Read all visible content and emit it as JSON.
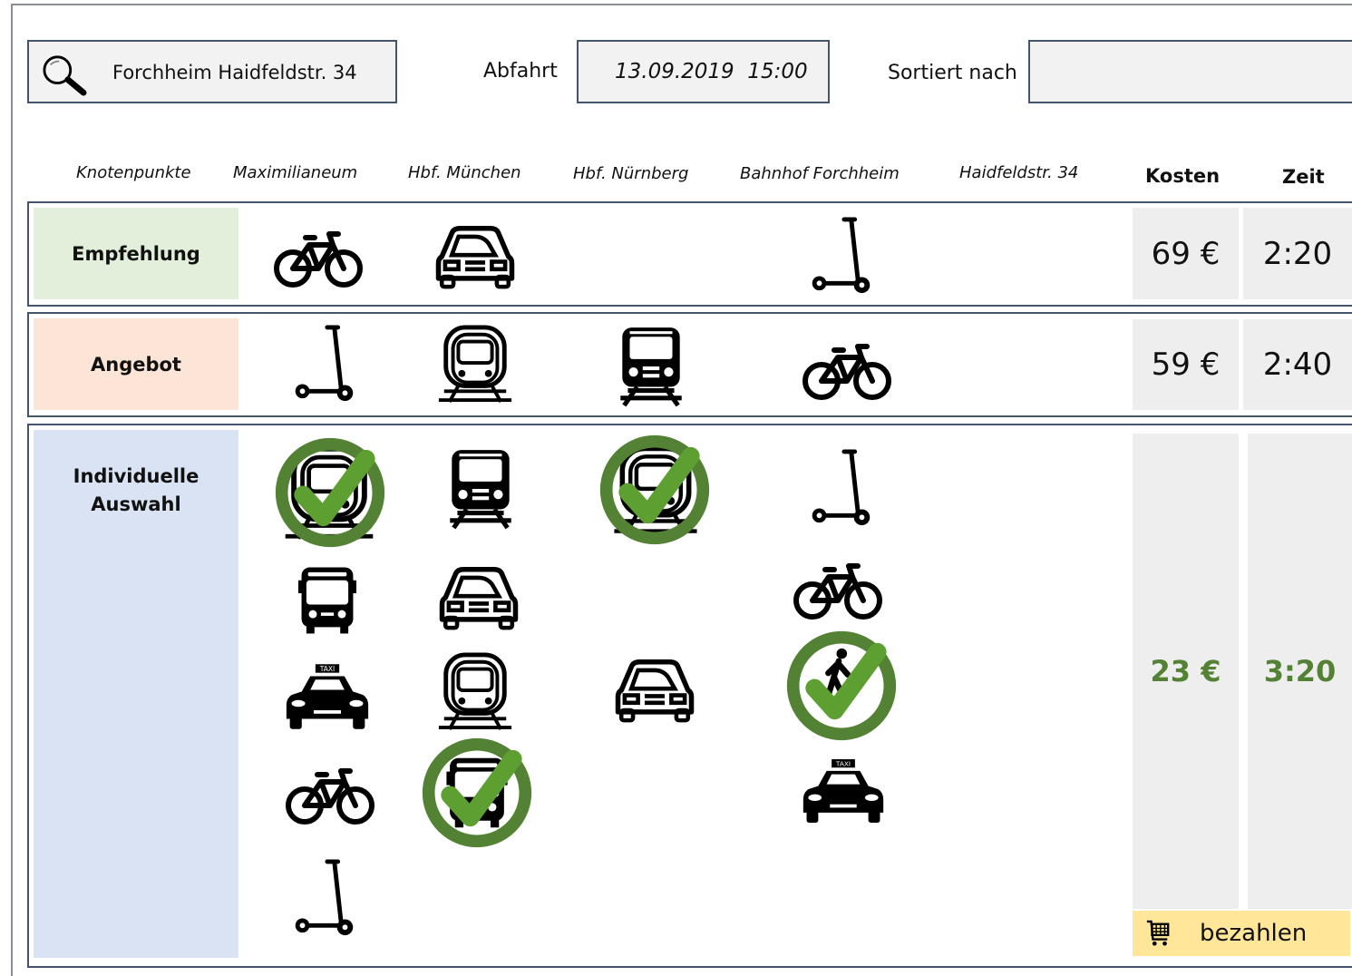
{
  "search": {
    "value": "Forchheim Haidfeldstr. 34"
  },
  "departure": {
    "label": "Abfahrt",
    "value": "13.09.2019  15:00"
  },
  "sort": {
    "label": "Sortiert nach",
    "value": ""
  },
  "columns": {
    "nodes": "Knotenpunkte",
    "c1": "Maximilianeum",
    "c2": "Hbf. München",
    "c3": "Hbf. Nürnberg",
    "c4": "Bahnhof Forchheim",
    "c5": "Haidfeldstr. 34",
    "cost": "Kosten",
    "time": "Zeit"
  },
  "rows": {
    "recommendation": {
      "label": "Empfehlung",
      "cost": "69 €",
      "time": "2:20",
      "bg": "#e2efda"
    },
    "offer": {
      "label": "Angebot",
      "cost": "59 €",
      "time": "2:40",
      "bg": "#fce4d6"
    },
    "individual": {
      "label": "Individuelle Auswahl",
      "cost": "23 €",
      "time": "3:20",
      "bg": "#dae3f3",
      "accent": "#548235"
    }
  },
  "pay": {
    "label": "bezahlen",
    "icon": "cart-icon"
  },
  "icons": [
    "bicycle-icon",
    "car-icon",
    "e-scooter-icon",
    "tram-icon",
    "train-icon",
    "bus-icon",
    "taxi-icon",
    "pedestrian-icon",
    "checkmark-icon",
    "search-icon"
  ]
}
